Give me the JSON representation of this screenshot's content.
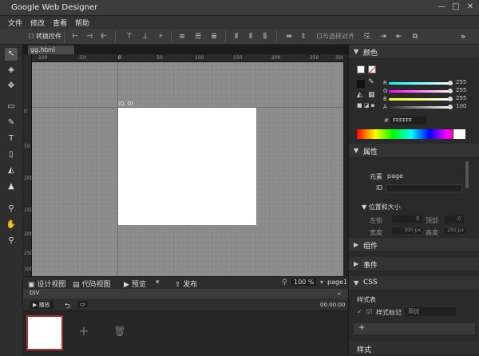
{
  "app": {
    "title": "Google Web Designer"
  },
  "window": {
    "minimize": "—",
    "maximize": "□",
    "close": "✕"
  },
  "menu": [
    "文件",
    "修改",
    "查看",
    "帮助"
  ],
  "toolbar": {
    "transform_toggle": "转换控件",
    "snap_label": "与选择对齐",
    "more": "»"
  },
  "tools": [
    "select-icon",
    "3d-rotate-icon",
    "3d-translate-icon",
    "tag-icon",
    "pen-icon",
    "text-icon",
    "shape-icon",
    "fill-icon",
    "stroke-icon",
    "pin-icon",
    "hand-icon",
    "zoom-icon"
  ],
  "document": {
    "tab": "gg.html",
    "ruler_top": [
      "-100",
      "-50",
      "0",
      "50",
      "100",
      "150",
      "200",
      "250",
      "300"
    ],
    "ruler_left": [
      "0",
      "50",
      "100",
      "150",
      "200",
      "250",
      "300"
    ],
    "origin_label": "(0, 0)"
  },
  "bottom_bar": {
    "design_view": "设计视图",
    "code_view": "代码视图",
    "preview": "预览",
    "publish": "发布",
    "zoom": "100 %",
    "page_name": "page1"
  },
  "timeline": {
    "crumb": "DIV",
    "play": "播放",
    "time_left": "00:00:00",
    "time_right": "00:00:00",
    "add_button": "+",
    "delete_button": "🗑"
  },
  "color_panel": {
    "title": "颜色",
    "channels": [
      {
        "name": "R",
        "value": 255
      },
      {
        "name": "G",
        "value": 255
      },
      {
        "name": "B",
        "value": 255
      },
      {
        "name": "A",
        "value": 100
      }
    ],
    "hex_prefix": "#",
    "hex": "FFFFFF"
  },
  "properties_panel": {
    "title": "属性",
    "element_label": "元素",
    "element_value": "page",
    "id_label": "ID",
    "position_label": "位置和大小",
    "left_label": "左侧",
    "left_value": "0",
    "top_label": "顶部",
    "top_value": "0",
    "width_label": "宽度",
    "width_value": "300 px",
    "height_label": "高度",
    "height_value": "250 px"
  },
  "components_title": "组件",
  "events_title": "事件",
  "css_panel": {
    "title": "CSS",
    "section": "样式表",
    "item": "样式标记",
    "placeholder": "添加",
    "add": "+"
  },
  "styles_title": "样式",
  "colors": {
    "accent": "#a33a3a",
    "panel": "#2a2a2a",
    "stage": "#8a8a8a"
  }
}
